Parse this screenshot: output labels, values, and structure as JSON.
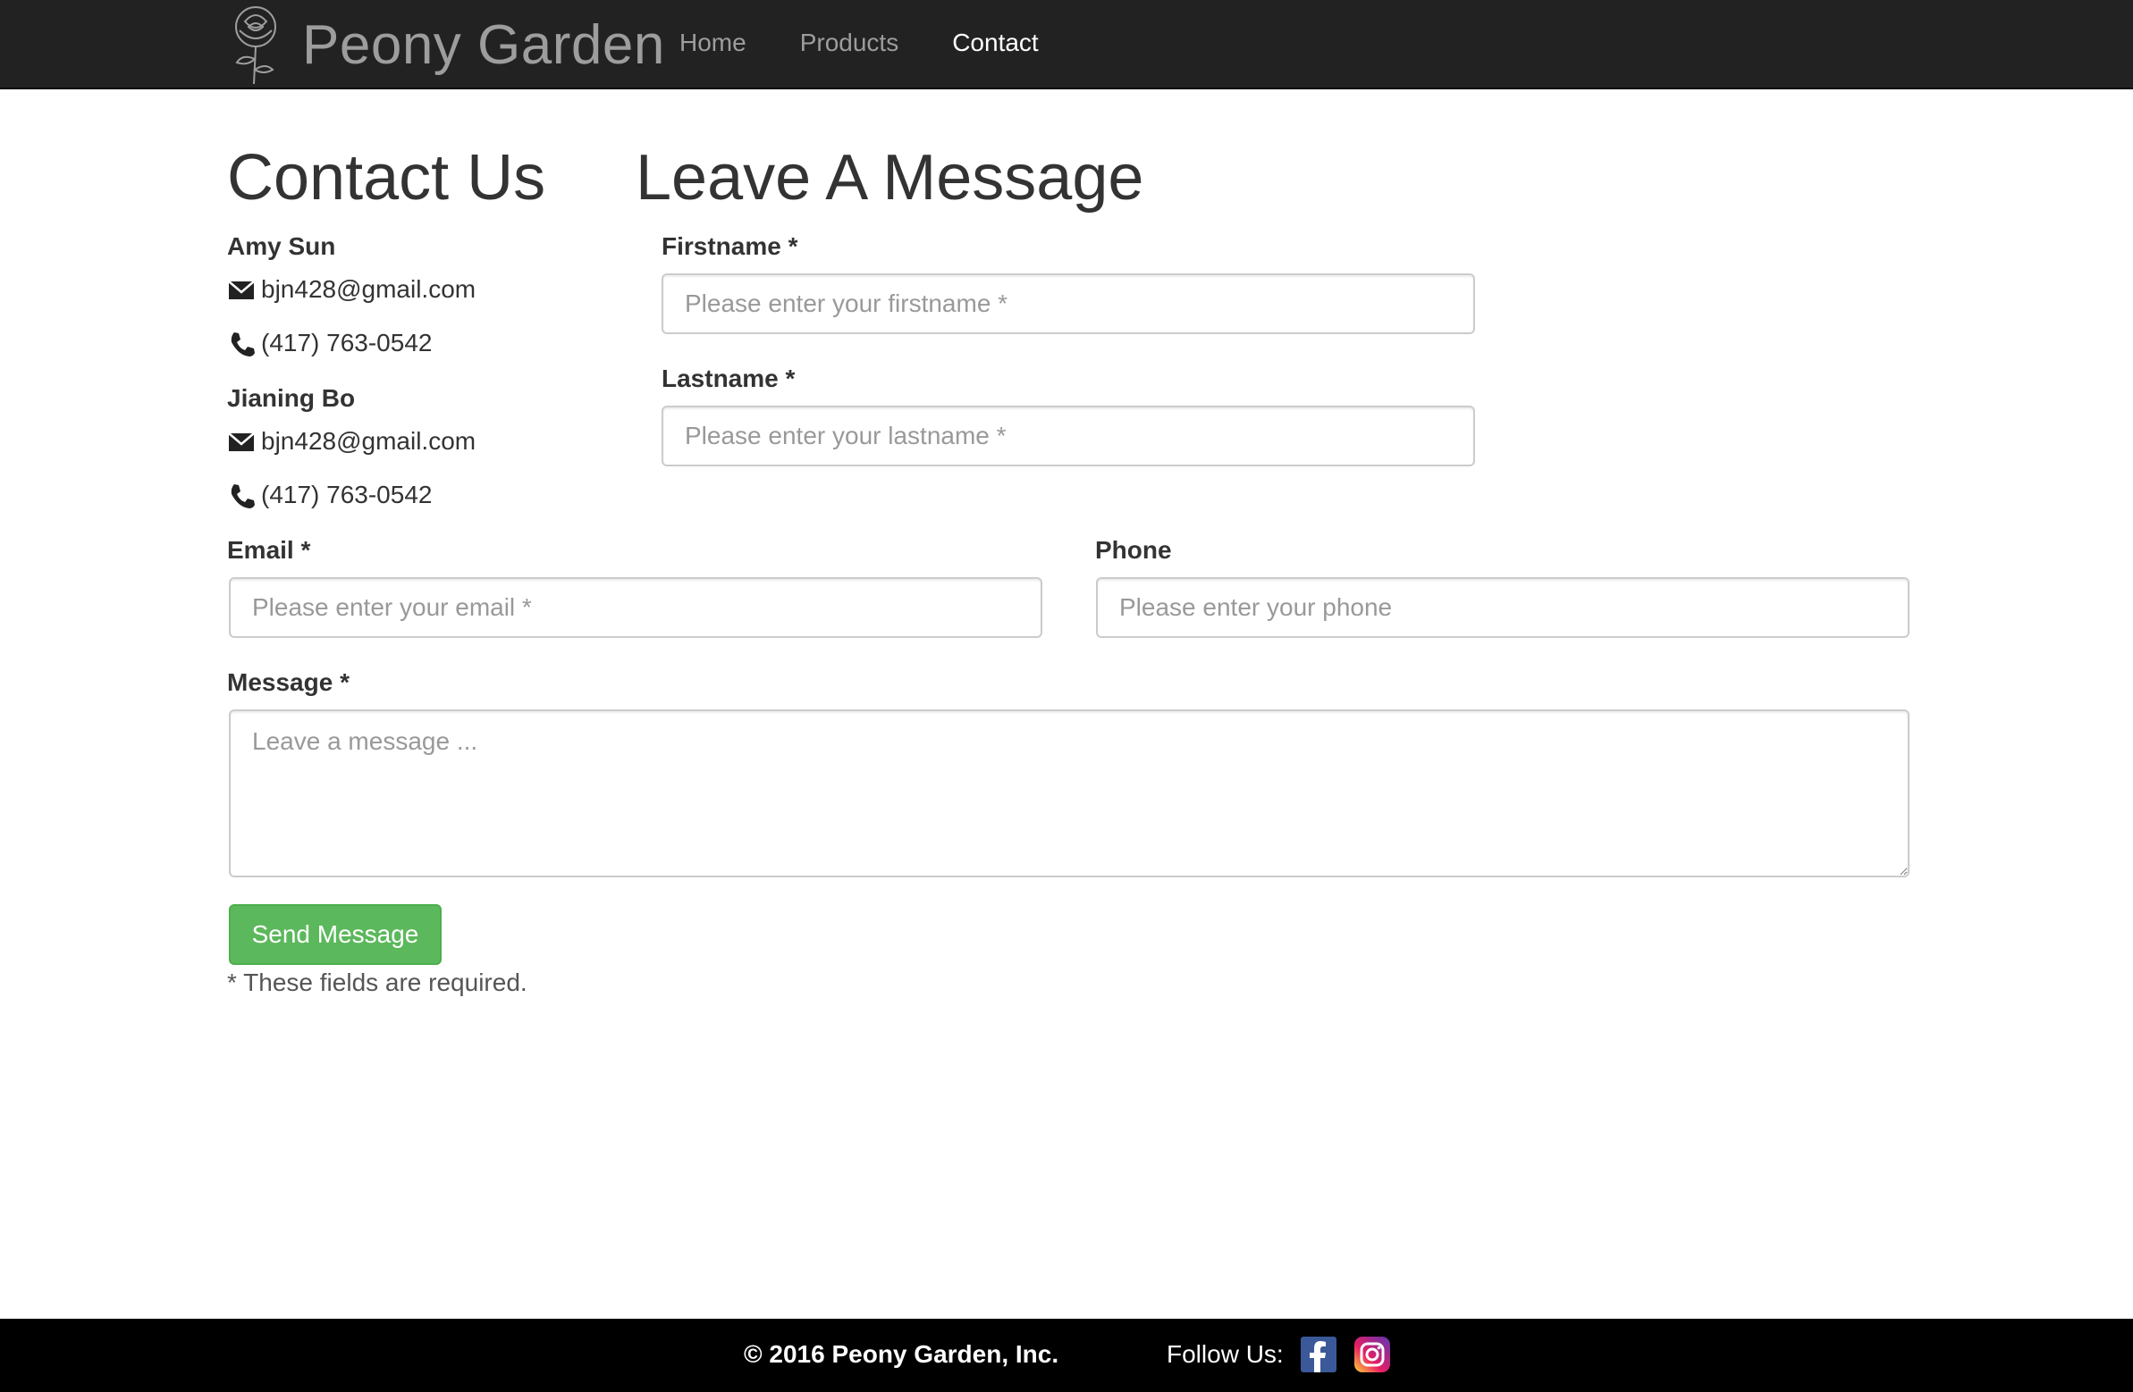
{
  "nav": {
    "brand": "Peony Garden",
    "links": [
      {
        "label": "Home",
        "active": false
      },
      {
        "label": "Products",
        "active": false
      },
      {
        "label": "Contact",
        "active": true
      }
    ]
  },
  "contact": {
    "heading": "Contact Us",
    "people": [
      {
        "name": "Amy Sun",
        "email": "bjn428@gmail.com",
        "phone": "(417) 763-0542"
      },
      {
        "name": "Jianing Bo",
        "email": "bjn428@gmail.com",
        "phone": "(417) 763-0542"
      }
    ]
  },
  "form": {
    "heading": "Leave A Message",
    "firstname": {
      "label": "Firstname *",
      "placeholder": "Please enter your firstname *"
    },
    "lastname": {
      "label": "Lastname *",
      "placeholder": "Please enter your lastname *"
    },
    "email": {
      "label": "Email *",
      "placeholder": "Please enter your email *"
    },
    "phone": {
      "label": "Phone",
      "placeholder": "Please enter your phone"
    },
    "message": {
      "label": "Message *",
      "placeholder": "Leave a message ..."
    },
    "submit_label": "Send Message",
    "required_note": "* These fields are required."
  },
  "footer": {
    "copyright": "© 2016 Peony Garden, Inc.",
    "follow_label": "Follow Us:"
  },
  "colors": {
    "navbar_bg": "#222222",
    "nav_link": "#9d9d9d",
    "nav_active": "#ffffff",
    "button_success": "#5cb85c",
    "footer_bg": "#000000",
    "facebook": "#3b5998"
  }
}
